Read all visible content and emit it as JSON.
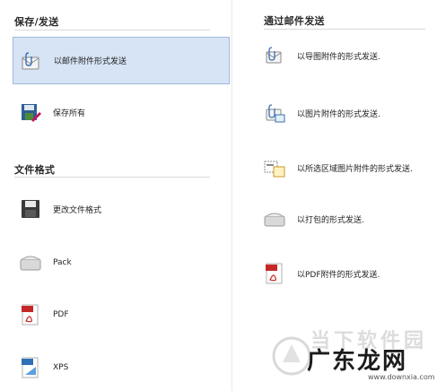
{
  "left": {
    "save_section_title": "保存/发送",
    "format_section_title": "文件格式",
    "save_items": [
      {
        "label": "以邮件附件形式发送",
        "icon": "email-attachment-icon"
      },
      {
        "label": "保存所有",
        "icon": "save-all-icon"
      }
    ],
    "format_items": [
      {
        "label": "更改文件格式",
        "icon": "floppy-disk-icon"
      },
      {
        "label": "Pack",
        "icon": "package-icon"
      },
      {
        "label": "PDF",
        "icon": "pdf-icon"
      },
      {
        "label": "XPS",
        "icon": "xps-icon"
      }
    ]
  },
  "right": {
    "section_title": "通过邮件发送",
    "items": [
      {
        "label": "以导图附件的形式发送.",
        "icon": "mindmap-attachment-icon"
      },
      {
        "label": "以图片附件的形式发送.",
        "icon": "image-attachment-icon"
      },
      {
        "label": "以所选区域图片附件的形式发送.",
        "icon": "selection-image-attachment-icon"
      },
      {
        "label": "以打包的形式发送.",
        "icon": "package-send-icon"
      },
      {
        "label": "以PDF附件的形式发送.",
        "icon": "pdf-attachment-icon"
      }
    ]
  },
  "watermark": {
    "line1": "当下软件园",
    "line2": "广东龙网",
    "url": "www.downxia.com"
  },
  "colors": {
    "selected_bg": "#d6e4f5",
    "selected_border": "#9fb9dd",
    "pdf_red": "#c62828",
    "xps_blue": "#2f6fb5"
  }
}
